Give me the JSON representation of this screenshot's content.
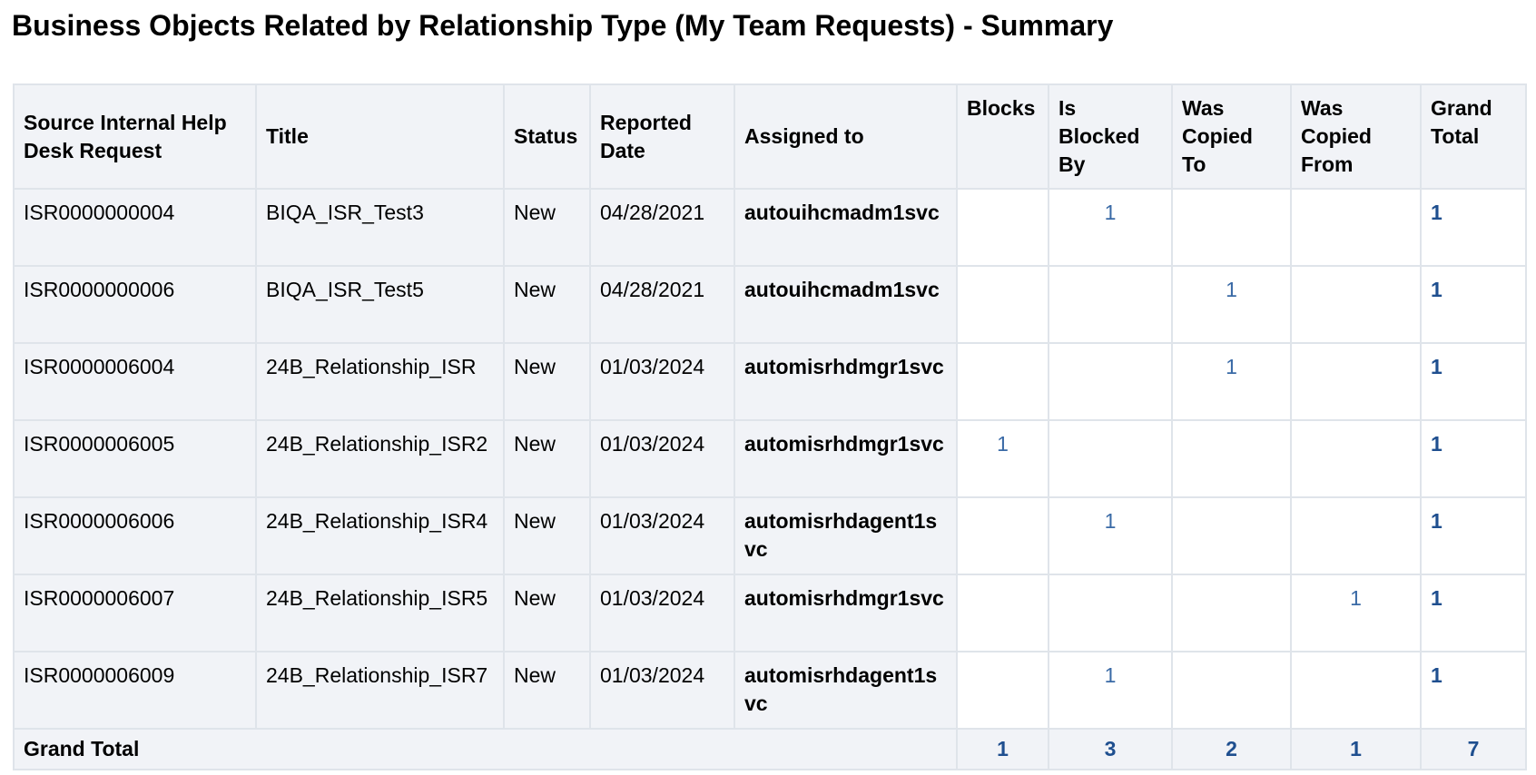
{
  "title": "Business Objects Related by Relationship Type (My Team Requests) - Summary",
  "columns": {
    "source": "Source Internal Help Desk Request",
    "title": "Title",
    "status": "Status",
    "reported_date": "Reported Date",
    "assigned_to": "Assigned to",
    "blocks": "Blocks",
    "is_blocked_by": "Is Blocked By",
    "was_copied_to": "Was Copied To",
    "was_copied_from": "Was Copied From",
    "grand_total": "Grand Total"
  },
  "rows": [
    {
      "source": "ISR0000000004",
      "title": "BIQA_ISR_Test3",
      "status": "New",
      "reported_date": "04/28/2021",
      "assigned_to": "autouihcmadm1svc",
      "blocks": "",
      "is_blocked_by": "1",
      "was_copied_to": "",
      "was_copied_from": "",
      "grand_total": "1"
    },
    {
      "source": "ISR0000000006",
      "title": "BIQA_ISR_Test5",
      "status": "New",
      "reported_date": "04/28/2021",
      "assigned_to": "autouihcmadm1svc",
      "blocks": "",
      "is_blocked_by": "",
      "was_copied_to": "1",
      "was_copied_from": "",
      "grand_total": "1"
    },
    {
      "source": "ISR0000006004",
      "title": "24B_Relationship_ISR",
      "status": "New",
      "reported_date": "01/03/2024",
      "assigned_to": "automisrhdmgr1svc",
      "blocks": "",
      "is_blocked_by": "",
      "was_copied_to": "1",
      "was_copied_from": "",
      "grand_total": "1"
    },
    {
      "source": "ISR0000006005",
      "title": "24B_Relationship_ISR2",
      "status": "New",
      "reported_date": "01/03/2024",
      "assigned_to": "automisrhdmgr1svc",
      "blocks": "1",
      "is_blocked_by": "",
      "was_copied_to": "",
      "was_copied_from": "",
      "grand_total": "1"
    },
    {
      "source": "ISR0000006006",
      "title": "24B_Relationship_ISR4",
      "status": "New",
      "reported_date": "01/03/2024",
      "assigned_to": "automisrhdagent1svc",
      "blocks": "",
      "is_blocked_by": "1",
      "was_copied_to": "",
      "was_copied_from": "",
      "grand_total": "1"
    },
    {
      "source": "ISR0000006007",
      "title": "24B_Relationship_ISR5",
      "status": "New",
      "reported_date": "01/03/2024",
      "assigned_to": "automisrhdmgr1svc",
      "blocks": "",
      "is_blocked_by": "",
      "was_copied_to": "",
      "was_copied_from": "1",
      "grand_total": "1"
    },
    {
      "source": "ISR0000006009",
      "title": "24B_Relationship_ISR7",
      "status": "New",
      "reported_date": "01/03/2024",
      "assigned_to": "automisrhdagent1svc",
      "blocks": "",
      "is_blocked_by": "1",
      "was_copied_to": "",
      "was_copied_from": "",
      "grand_total": "1"
    }
  ],
  "totals": {
    "label": "Grand Total",
    "blocks": "1",
    "is_blocked_by": "3",
    "was_copied_to": "2",
    "was_copied_from": "1",
    "grand_total": "7"
  },
  "colors": {
    "header_bg": "#f1f3f7",
    "border": "#dfe4ea",
    "link": "#3a6aa6",
    "total_link": "#1f4f8f"
  }
}
